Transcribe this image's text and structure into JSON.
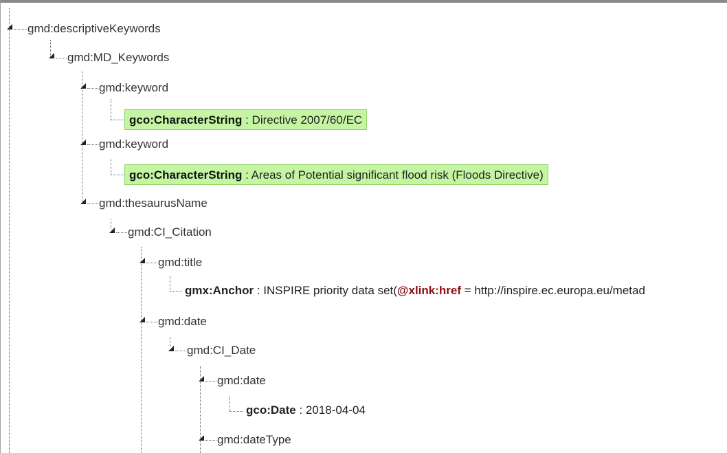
{
  "nodes": [
    {
      "label": "gmd:descriptiveKeywords"
    },
    {
      "label": "gmd:MD_Keywords"
    },
    {
      "label": "gmd:keyword"
    },
    {
      "label": "gmd:keyword"
    },
    {
      "label": "gmd:thesaurusName"
    },
    {
      "label": "gmd:CI_Citation"
    },
    {
      "label": "gmd:title"
    },
    {
      "label": "gmd:date"
    },
    {
      "label": "gmd:CI_Date"
    },
    {
      "label": "gmd:date"
    },
    {
      "label": "gmd:dateType"
    }
  ],
  "leaves": [
    {
      "name": "gco:CharacterString",
      "sep": " : ",
      "value": "Directive 2007/60/EC"
    },
    {
      "name": "gco:CharacterString",
      "sep": " : ",
      "value": "Areas of Potential significant flood risk (Floods Directive)"
    },
    {
      "name": "gmx:Anchor",
      "sep": " : ",
      "value": "INSPIRE priority data set(",
      "attr": "@xlink:href",
      "attr_sep": " = ",
      "attr_value": "http://inspire.ec.europa.eu/metad"
    },
    {
      "name": "gco:Date",
      "sep": " : ",
      "value": "2018-04-04"
    }
  ],
  "colors": {
    "highlight_bg": "#c5f5a3",
    "highlight_border": "#8fd66a",
    "attribute": "#8b1111",
    "text": "#333333"
  }
}
